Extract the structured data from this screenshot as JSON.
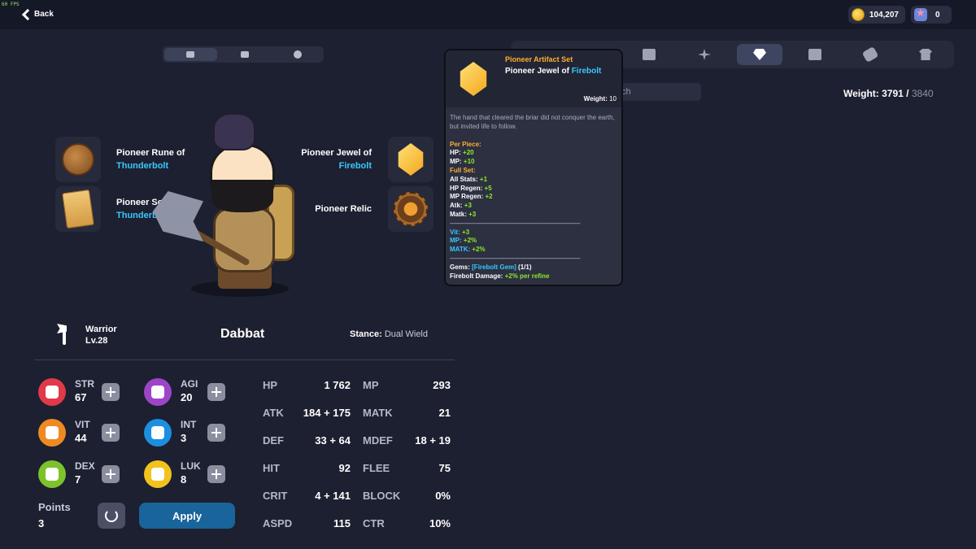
{
  "topbar": {
    "fps": "60 FPS",
    "back_label": "Back",
    "coins": "104,207",
    "gems": "0"
  },
  "equipment": {
    "slots": [
      {
        "name": "Pioneer Rune of",
        "element": "Thunderbolt"
      },
      {
        "name": "Pioneer Scroll",
        "element": "Thunderbolt"
      },
      {
        "name": "Pioneer Jewel of",
        "element": "Firebolt"
      },
      {
        "name": "Pioneer Relic",
        "element": ""
      }
    ]
  },
  "character": {
    "class": "Warrior",
    "level": "Lv.28",
    "name": "Dabbat",
    "stance_label": "Stance:",
    "stance_value": "Dual Wield"
  },
  "attributes": [
    {
      "name": "STR",
      "value": "67",
      "color": "#e0394a"
    },
    {
      "name": "AGI",
      "value": "20",
      "color": "#9d45c8"
    },
    {
      "name": "VIT",
      "value": "44",
      "color": "#ef8a22"
    },
    {
      "name": "INT",
      "value": "3",
      "color": "#1c8fe0"
    },
    {
      "name": "DEX",
      "value": "7",
      "color": "#7dc22a"
    },
    {
      "name": "LUK",
      "value": "8",
      "color": "#f2c31c"
    }
  ],
  "points": {
    "label": "Points",
    "value": "3"
  },
  "apply_label": "Apply",
  "stats": [
    {
      "name": "HP",
      "value": "1 762"
    },
    {
      "name": "MP",
      "value": "293"
    },
    {
      "name": "ATK",
      "value": "184 + 175"
    },
    {
      "name": "MATK",
      "value": "21"
    },
    {
      "name": "DEF",
      "value": "33 + 64"
    },
    {
      "name": "MDEF",
      "value": "18 + 19"
    },
    {
      "name": "HIT",
      "value": "92"
    },
    {
      "name": "FLEE",
      "value": "75"
    },
    {
      "name": "CRIT",
      "value": "4 + 141"
    },
    {
      "name": "BLOCK",
      "value": "0%"
    },
    {
      "name": "ASPD",
      "value": "115"
    },
    {
      "name": "CTR",
      "value": "10%"
    }
  ],
  "inventory": {
    "search_placeholder": "ch",
    "weight_label": "Weight:",
    "weight_current": "3791",
    "weight_max": "3840",
    "tabs": [
      "cards-icon",
      "snowflake-icon",
      "gem-icon",
      "book-icon",
      "scroll-icon",
      "shirt-icon"
    ]
  },
  "tooltip": {
    "set_name": "Pioneer Artifact Set",
    "item_name": "Pioneer Jewel of",
    "item_element": "Firebolt",
    "weight_label": "Weight:",
    "weight_value": "10",
    "description": "The hand that cleared the briar did not conquer the earth, but invited life to follow.",
    "per_piece_label": "Per Piece:",
    "per_piece": [
      {
        "label": "HP:",
        "value": "+20"
      },
      {
        "label": "MP:",
        "value": "+10"
      }
    ],
    "full_set_label": "Full Set:",
    "full_set": [
      {
        "label": "All Stats:",
        "value": "+1"
      },
      {
        "label": "HP Regen:",
        "value": "+5"
      },
      {
        "label": "MP Regen:",
        "value": "+2"
      },
      {
        "label": "Atk:",
        "value": "+3"
      },
      {
        "label": "Matk:",
        "value": "+3"
      }
    ],
    "bonus": [
      {
        "label": "Vit:",
        "value": "+3"
      },
      {
        "label": "MP:",
        "value": "+2%"
      },
      {
        "label": "MATK:",
        "value": "+2%"
      }
    ],
    "gems_label": "Gems:",
    "gems_value": "[Firebolt Gem]",
    "gems_count": "(1/1)",
    "refine_label": "Firebolt Damage:",
    "refine_value": "+2% per refine",
    "separator": "--------------------------------------------------------------------------"
  }
}
